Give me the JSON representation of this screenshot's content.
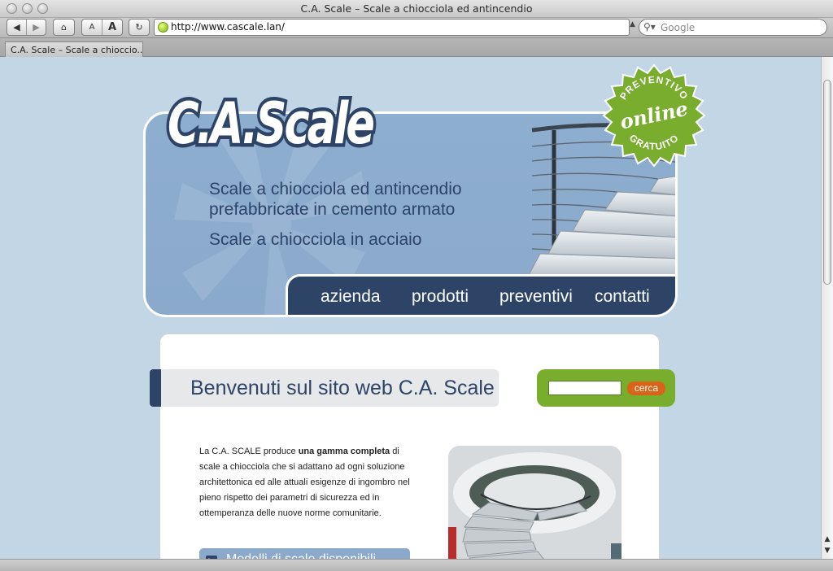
{
  "window": {
    "title": "C.A. Scale – Scale a chiocciola ed antincendio"
  },
  "toolbar": {
    "font_small": "A",
    "font_large": "A",
    "url": "http://www.cascale.lan/",
    "search_placeholder": "Google"
  },
  "tabs": [
    {
      "label": "C.A. Scale – Scale a chioccio..."
    }
  ],
  "header": {
    "logo_text": "C.A.Scale",
    "taglines": [
      "Scale a chiocciola ed antincendio",
      "prefabbricate in cemento armato",
      "Scale a chiocciola in acciaio"
    ],
    "badge": {
      "top": "PREVENTIVO",
      "middle": "online",
      "bottom": "GRATUITO"
    }
  },
  "nav": {
    "items": [
      "azienda",
      "prodotti",
      "preventivi",
      "contatti"
    ]
  },
  "content": {
    "welcome": "Benvenuti sul sito web C.A. Scale",
    "search_button": "cerca",
    "intro_prefix": "La C.A. SCALE produce ",
    "intro_bold": "una gamma completa",
    "intro_suffix": " di scale a chiocciola che si adattano ad ogni soluzione architettonica ed alle attuali esigenze di ingombro nel pieno rispetto dei parametri di sicurezza ed in ottemperanza delle nuove norme comunitarie.",
    "models_label": "Modelli di scale disponibili"
  },
  "colors": {
    "page_bg": "#c3d6e5",
    "navy": "#2d4467",
    "banner_blue": "#8eaed0",
    "green": "#79ad2e",
    "orange": "#d8641a"
  }
}
